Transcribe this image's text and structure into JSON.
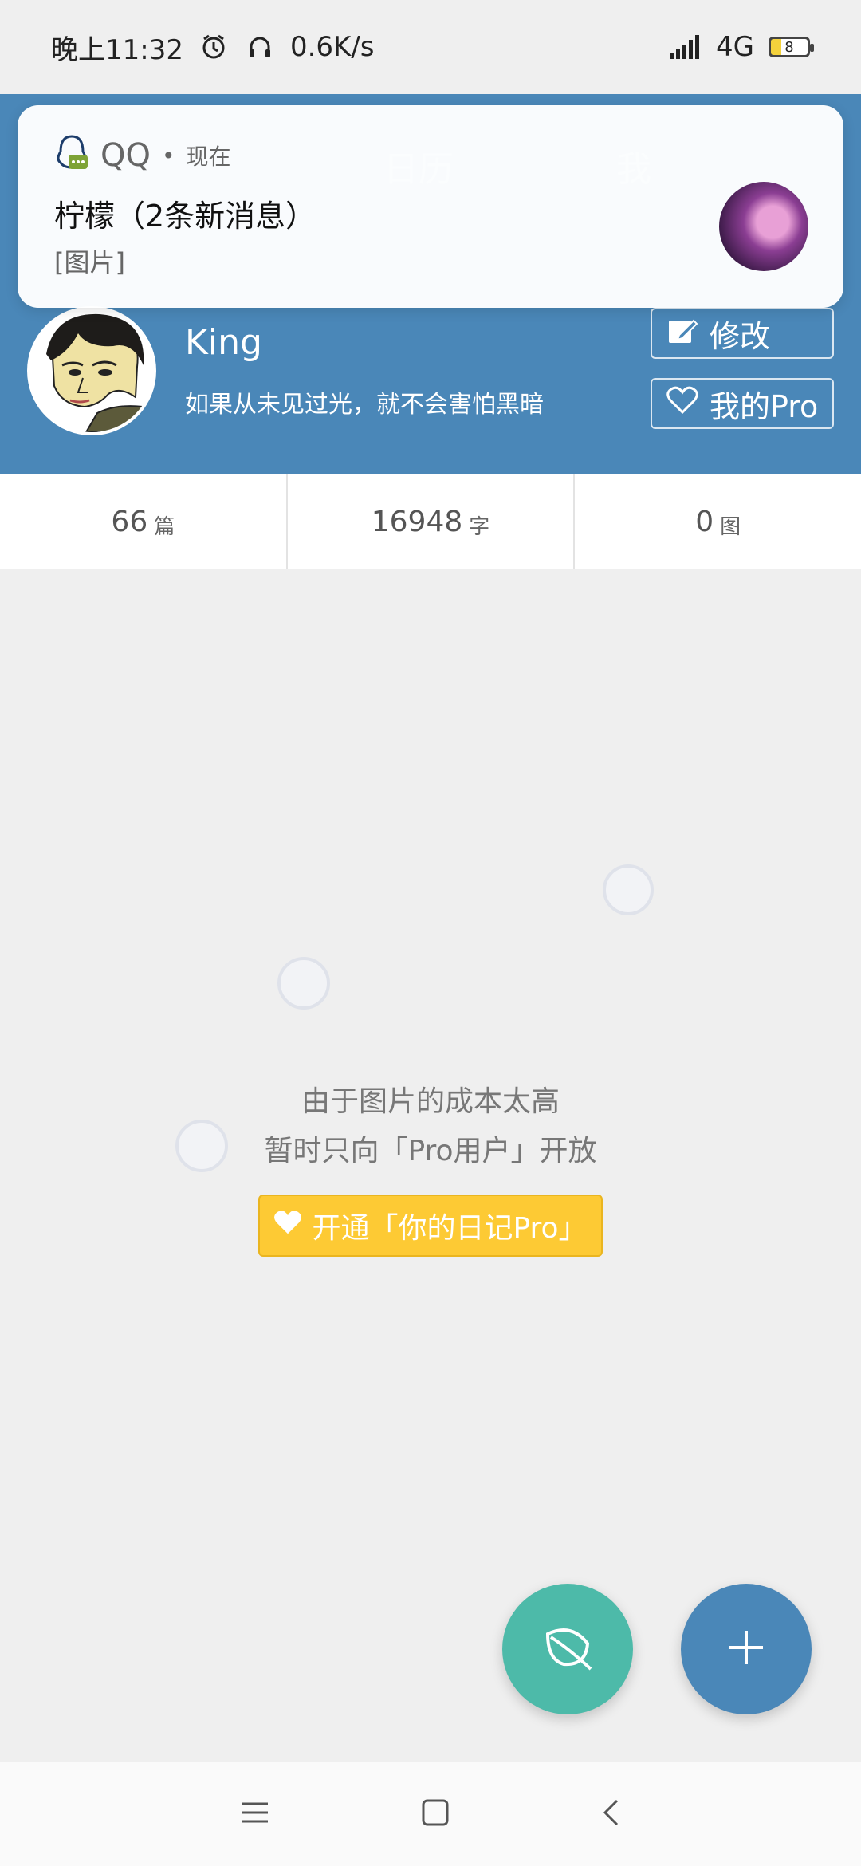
{
  "status_bar": {
    "time": "晚上11:32",
    "speed": "0.6K/s",
    "network": "4G",
    "battery": "8"
  },
  "tabs": [
    "日历",
    "我"
  ],
  "profile": {
    "name": "King",
    "bio": "如果从未见过光，就不会害怕黑暗",
    "edit_label": "修改",
    "pro_label": "我的Pro"
  },
  "stats": [
    {
      "value": "66",
      "unit": "篇"
    },
    {
      "value": "16948",
      "unit": "字"
    },
    {
      "value": "0",
      "unit": "图"
    }
  ],
  "empty_state": {
    "line1": "由于图片的成本太高",
    "line2": "暂时只向「Pro用户」开放",
    "cta_label": "开通「你的日记Pro」"
  },
  "notification": {
    "app": "QQ",
    "time": "现在",
    "title": "柠檬（2条新消息）",
    "body": "[图片]"
  },
  "colors": {
    "primary": "#4a87b8",
    "accent": "#fdca34",
    "leaf_fab": "#4dbaa9"
  },
  "icons": [
    "alarm-icon",
    "headphones-icon",
    "signal-icon",
    "battery-icon",
    "edit-icon",
    "heart-icon",
    "leaf-icon",
    "plus-icon",
    "menu-icon",
    "home-icon",
    "back-icon",
    "qq-icon"
  ]
}
